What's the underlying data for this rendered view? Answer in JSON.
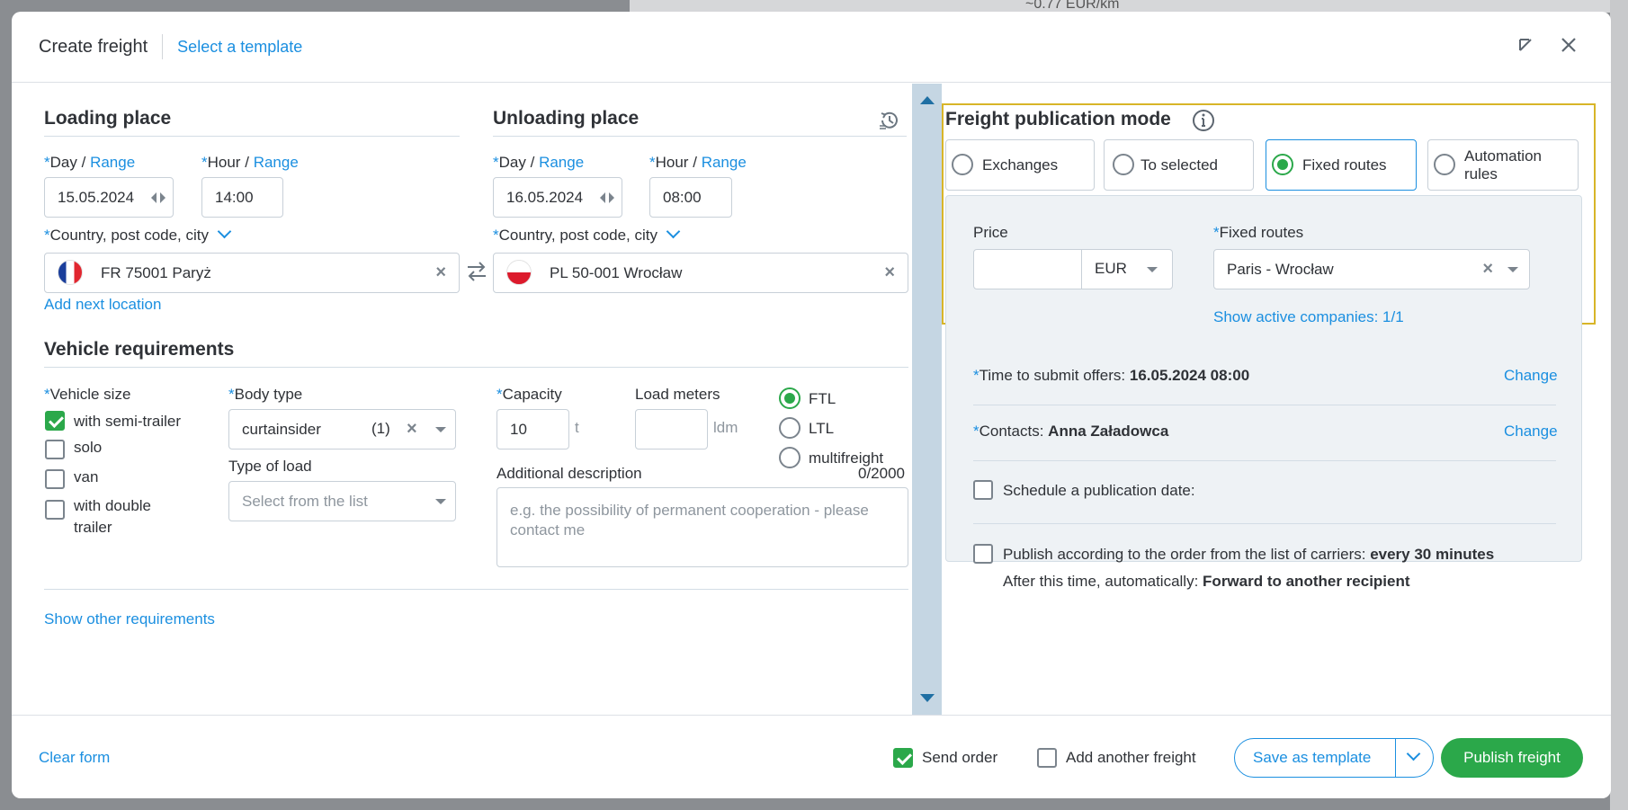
{
  "background": {
    "snippet": "~0.77 EUR/km"
  },
  "header": {
    "title": "Create freight",
    "template_link": "Select a template"
  },
  "loading": {
    "title": "Loading place",
    "day_label": "Day",
    "slash": "/",
    "range": "Range",
    "hour_label": "Hour",
    "date": "15.05.2024",
    "hour": "14:00",
    "location_label": "Country, post code, city",
    "location": "FR 75001 Paryż",
    "add_next": "Add next location"
  },
  "unloading": {
    "title": "Unloading place",
    "day_label": "Day",
    "slash": "/",
    "range": "Range",
    "hour_label": "Hour",
    "date": "16.05.2024",
    "hour": "08:00",
    "location_label": "Country, post code, city",
    "location": "PL 50-001 Wrocław"
  },
  "vehicle": {
    "title": "Vehicle requirements",
    "size_label": "Vehicle size",
    "sizes": [
      {
        "label": "with semi-trailer",
        "checked": true
      },
      {
        "label": "solo",
        "checked": false
      },
      {
        "label": "van",
        "checked": false
      },
      {
        "label": "with double",
        "label2": "trailer",
        "checked": false
      }
    ],
    "body_label": "Body type",
    "body_value": "curtainsider",
    "body_count": "(1)",
    "load_type_label": "Type of load",
    "load_type_placeholder": "Select from the list",
    "capacity_label": "Capacity",
    "capacity_value": "10",
    "capacity_unit": "t",
    "ldm_label": "Load meters",
    "ldm_unit": "ldm",
    "freight_types": [
      {
        "label": "FTL",
        "selected": true
      },
      {
        "label": "LTL",
        "selected": false
      },
      {
        "label": "multifreight",
        "selected": false
      }
    ],
    "desc_label": "Additional description",
    "desc_counter": "0/2000",
    "desc_placeholder": "e.g. the possibility of permanent cooperation - please contact me",
    "show_other": "Show other requirements"
  },
  "publication": {
    "title": "Freight publication mode",
    "modes": [
      {
        "label": "Exchanges",
        "selected": false
      },
      {
        "label": "To selected",
        "selected": false
      },
      {
        "label": "Fixed routes",
        "selected": true
      },
      {
        "label": "Automation rules",
        "selected": false
      }
    ],
    "price_label": "Price",
    "currency": "EUR",
    "routes_label": "Fixed routes",
    "routes_value": "Paris - Wrocław",
    "active_companies": "Show active companies: 1/1",
    "time_label": "Time to submit offers:",
    "time_value": "16.05.2024 08:00",
    "contacts_label": "Contacts:",
    "contacts_value": "Anna Załadowca",
    "change": "Change",
    "schedule_label": "Schedule a publication date:",
    "order_label": "Publish according to the order from the list of carriers:",
    "order_value": "every 30 minutes",
    "after_label": "After this time, automatically:",
    "after_value": "Forward to another recipient"
  },
  "footer": {
    "clear": "Clear form",
    "send_order": "Send order",
    "send_order_checked": true,
    "add_another": "Add another freight",
    "save_template": "Save as template",
    "publish": "Publish freight"
  },
  "colors": {
    "accent": "#1b8fe0",
    "green": "#2ba84a",
    "highlight": "#d8b528"
  }
}
